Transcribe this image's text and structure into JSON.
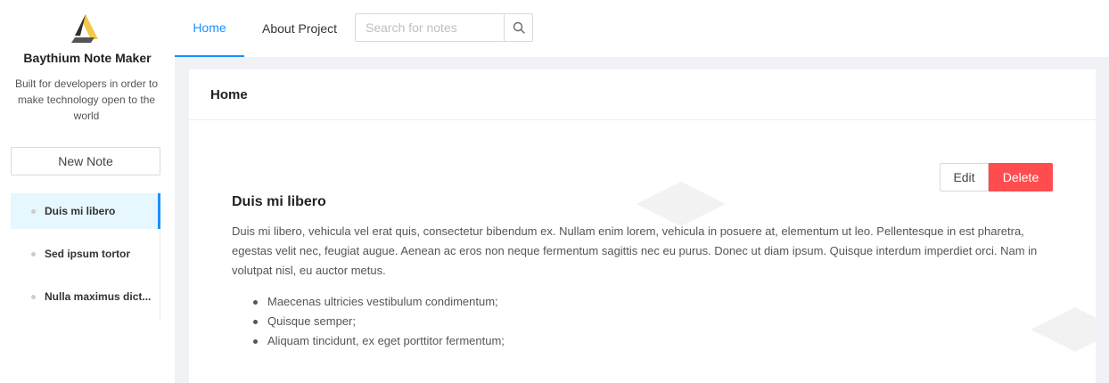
{
  "sidebar": {
    "app_title": "Baythium Note Maker",
    "app_description": "Built for developers in order to make technology open to the world",
    "new_note_label": "New Note",
    "notes": [
      {
        "label": "Duis mi libero",
        "active": true
      },
      {
        "label": "Sed ipsum tortor",
        "active": false
      },
      {
        "label": "Nulla maximus dict...",
        "active": false
      }
    ]
  },
  "nav": {
    "tabs": [
      {
        "label": "Home",
        "active": true
      },
      {
        "label": "About Project",
        "active": false
      }
    ],
    "search": {
      "placeholder": "Search for notes",
      "value": "",
      "icon": "search-icon"
    }
  },
  "card": {
    "header": "Home",
    "edit_label": "Edit",
    "delete_label": "Delete",
    "note": {
      "title": "Duis mi libero",
      "body": "Duis mi libero, vehicula vel erat quis, consectetur bibendum ex. Nullam enim lorem, vehicula in posuere at, elementum ut leo. Pellentesque in est pharetra, egestas velit nec, feugiat augue. Aenean ac eros non neque fermentum sagittis nec eu purus. Donec ut diam ipsum. Quisque interdum imperdiet orci. Nam in volutpat nisl, eu auctor metus.",
      "bullets": [
        "Maecenas ultricies vestibulum condimentum;",
        "Quisque semper;",
        "Aliquam tincidunt, ex eget porttitor fermentum;"
      ]
    }
  },
  "colors": {
    "accent": "#1890ff",
    "danger": "#ff4d4f",
    "active_item_bg": "#e6f7ff",
    "page_bg": "#f0f2f5"
  }
}
